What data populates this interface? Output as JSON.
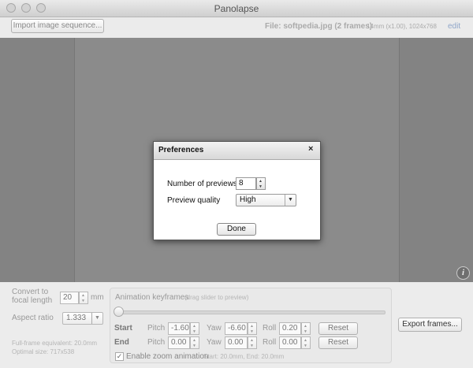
{
  "window": {
    "title": "Panolapse"
  },
  "toolbar": {
    "import_label": "Import image sequence...",
    "file_info": "File: softpedia.jpg (2 frames)",
    "file_meta": "14mm (x1.00), 1024x768",
    "edit_label": "edit"
  },
  "canvas": {
    "info_icon": "i"
  },
  "preferences": {
    "title": "Preferences",
    "close_glyph": "×",
    "num_previews_label": "Number of previews",
    "num_previews_value": "8",
    "quality_label": "Preview quality",
    "quality_value": "High",
    "done_label": "Done"
  },
  "left_settings": {
    "convert_label_1": "Convert to",
    "convert_label_2": "focal length",
    "focal_value": "20",
    "focal_unit": "mm",
    "aspect_label": "Aspect ratio",
    "aspect_value": "1.333",
    "fullframe_text": "Full-frame equivalent: 20.0mm",
    "optimal_text": "Optimal size: 717x538"
  },
  "animation": {
    "title": "Animation keyframes",
    "hint": "(drag slider to preview)",
    "start_label": "Start",
    "end_label": "End",
    "pitch_label": "Pitch",
    "yaw_label": "Yaw",
    "roll_label": "Roll",
    "start_pitch": "-1.60",
    "start_yaw": "-6.60",
    "start_roll": "0.20",
    "end_pitch": "0.00",
    "end_yaw": "0.00",
    "end_roll": "0.00",
    "reset_label": "Reset",
    "zoom_label": "Enable zoom animation",
    "zoom_checked": "✓",
    "zoom_info": "Start: 20.0mm, End: 20.0mm"
  },
  "export": {
    "label": "Export frames..."
  },
  "icons": {
    "close": "close-traffic-light-icon",
    "minimize": "minimize-traffic-light-icon",
    "maximize": "maximize-traffic-light-icon",
    "info": "info-icon",
    "dialog_close": "close-icon",
    "dropdown": "chevron-down-icon",
    "stepper": "stepper-arrows-icon"
  }
}
